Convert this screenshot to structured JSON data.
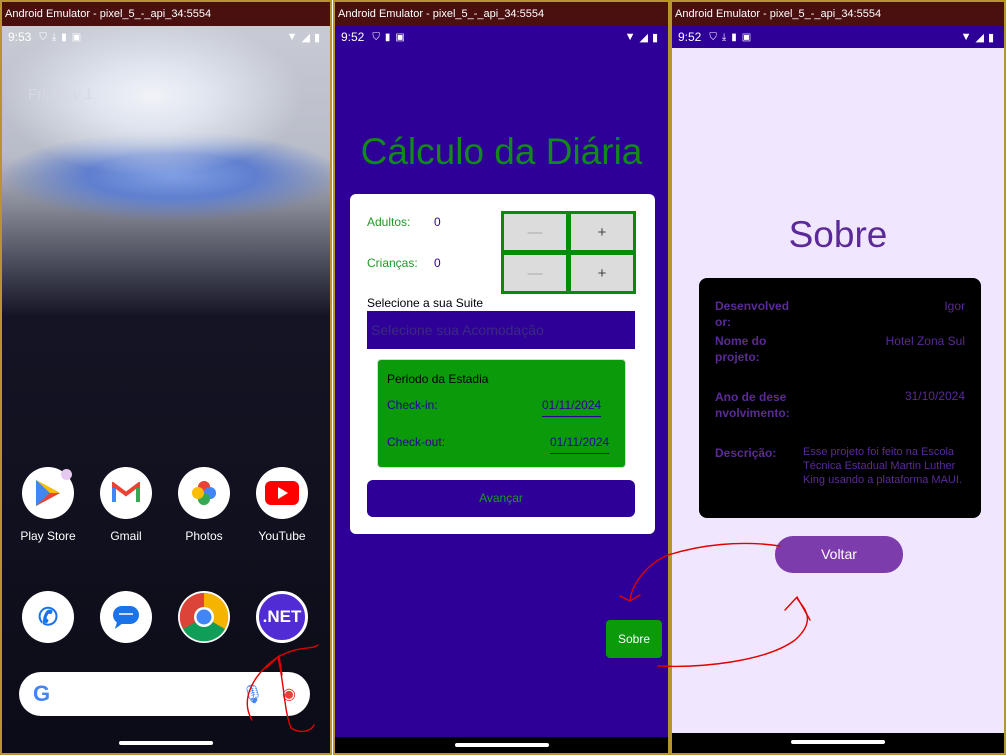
{
  "emulators": [
    {
      "title": "Android Emulator - pixel_5_-_api_34:5554",
      "time": "9:53"
    },
    {
      "title": "Android Emulator - pixel_5_-_api_34:5554",
      "time": "9:52"
    },
    {
      "title": "Android Emulator - pixel_5_-_api_34:5554",
      "time": "9:52"
    }
  ],
  "home": {
    "date": "Fri, Nov 1",
    "apps": [
      {
        "label": "Play Store",
        "icon": "play-store-icon"
      },
      {
        "label": "Gmail",
        "icon": "gmail-icon"
      },
      {
        "label": "Photos",
        "icon": "photos-icon"
      },
      {
        "label": "YouTube",
        "icon": "youtube-icon"
      }
    ],
    "dock": [
      {
        "icon": "phone-icon"
      },
      {
        "icon": "messages-icon"
      },
      {
        "icon": "chrome-icon"
      },
      {
        "icon": "dotnet-icon",
        "text": ".NET"
      }
    ],
    "search_logo": "G"
  },
  "calc": {
    "title": "Cálculo da Diária",
    "adults_label": "Adultos:",
    "adults_value": "0",
    "children_label": "Crianças:",
    "children_value": "0",
    "minus": "—",
    "plus": "+",
    "suite_label": "Selecione a sua Suite",
    "suite_placeholder": "Selecione sua Acomodação",
    "period_title": "Periodo da Estadia",
    "checkin_label": "Check-in:",
    "checkin_value": "01/11/2024",
    "checkout_label": "Check-out:",
    "checkout_value": "01/11/2024",
    "next_button": "Avançar",
    "about_button": "Sobre"
  },
  "about": {
    "title": "Sobre",
    "dev_label_1": "Desenvolved",
    "dev_label_2": "or:",
    "dev_value": "Igor",
    "project_label_1": "Nome do",
    "project_label_2": "projeto:",
    "project_value": "Hotel Zona Sul",
    "year_label_1": "Ano de dese",
    "year_label_2": "nvolvimento:",
    "year_value": "31/10/2024",
    "desc_label": "Descrição:",
    "desc_value": "Esse projeto foi feito na Escola Técnica Estadual Martin Luther King usando a plataforma MAUI.",
    "back_button": "Voltar"
  },
  "colors": {
    "app_primary": "#2e0097",
    "green": "#0a9a0a",
    "about_accent": "#5b2a98",
    "annotation_red": "#e00000"
  }
}
